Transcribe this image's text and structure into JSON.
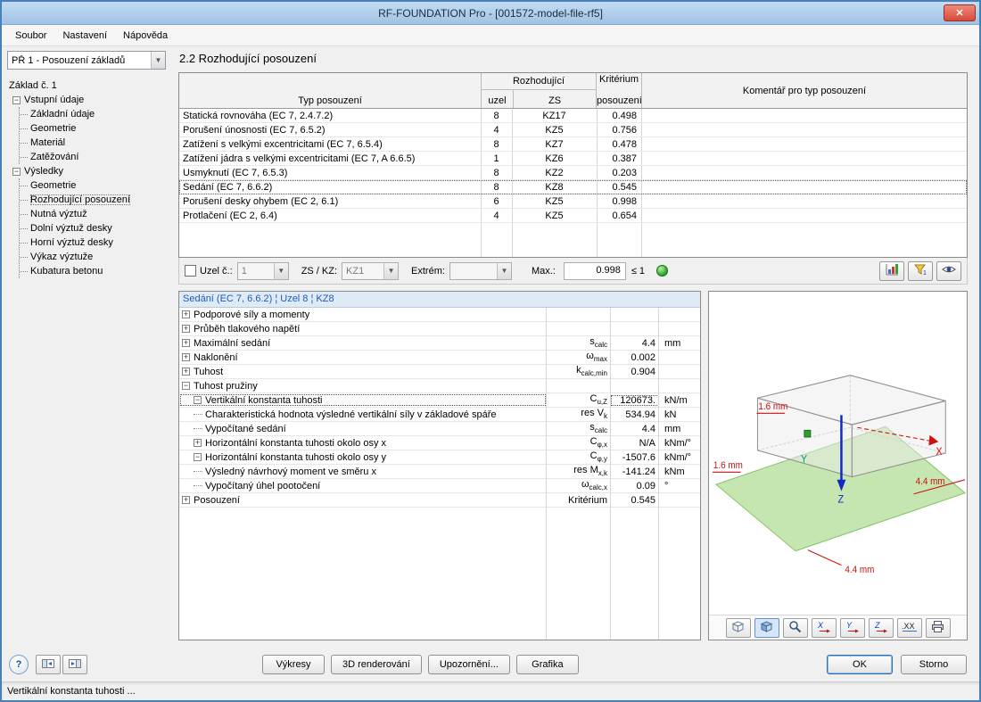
{
  "window": {
    "title": "RF-FOUNDATION Pro - [001572-model-file-rf5]",
    "close_glyph": "✕"
  },
  "menu": {
    "items": [
      "Soubor",
      "Nastavení",
      "Nápověda"
    ]
  },
  "navigation": {
    "case_selector": "PŘ 1 - Posouzení základů",
    "tree": [
      {
        "label": "Základ č. 1",
        "level": 0,
        "exp": ""
      },
      {
        "label": "Vstupní údaje",
        "level": 1,
        "exp": "-"
      },
      {
        "label": "Základní údaje",
        "level": 2,
        "exp": ""
      },
      {
        "label": "Geometrie",
        "level": 2,
        "exp": ""
      },
      {
        "label": "Materiál",
        "level": 2,
        "exp": ""
      },
      {
        "label": "Zatěžování",
        "level": 2,
        "exp": ""
      },
      {
        "label": "Výsledky",
        "level": 1,
        "exp": "-"
      },
      {
        "label": "Geometrie",
        "level": 2,
        "exp": ""
      },
      {
        "label": "Rozhodující posouzení",
        "level": 2,
        "exp": "",
        "selected": true
      },
      {
        "label": "Nutná výztuž",
        "level": 2,
        "exp": ""
      },
      {
        "label": "Dolní výztuž desky",
        "level": 2,
        "exp": ""
      },
      {
        "label": "Horní výztuž desky",
        "level": 2,
        "exp": ""
      },
      {
        "label": "Výkaz výztuže",
        "level": 2,
        "exp": ""
      },
      {
        "label": "Kubatura betonu",
        "level": 2,
        "exp": ""
      }
    ]
  },
  "section": {
    "title": "2.2 Rozhodující posouzení"
  },
  "results_table": {
    "headers": {
      "type": "Typ posouzení",
      "governing": "Rozhodující",
      "node": "uzel",
      "zs": "ZS",
      "criterion_line1": "Kritérium",
      "criterion_line2": "posouzení",
      "comment": "Komentář pro typ posouzení"
    },
    "rows": [
      {
        "type": "Statická rovnováha (EC 7, 2.4.7.2)",
        "node": "8",
        "zs": "KZ17",
        "criterion": "0.498",
        "comment": ""
      },
      {
        "type": "Porušení únosnosti (EC 7, 6.5.2)",
        "node": "4",
        "zs": "KZ5",
        "criterion": "0.756",
        "comment": ""
      },
      {
        "type": "Zatížení s velkými excentricitami (EC 7, 6.5.4)",
        "node": "8",
        "zs": "KZ7",
        "criterion": "0.478",
        "comment": ""
      },
      {
        "type": "Zatížení jádra s velkými excentricitami (EC 7, A 6.6.5)",
        "node": "1",
        "zs": "KZ6",
        "criterion": "0.387",
        "comment": ""
      },
      {
        "type": "Usmyknutí (EC 7, 6.5.3)",
        "node": "8",
        "zs": "KZ2",
        "criterion": "0.203",
        "comment": ""
      },
      {
        "type": "Sedání (EC 7, 6.6.2)",
        "node": "8",
        "zs": "KZ8",
        "criterion": "0.545",
        "comment": "",
        "selected": true
      },
      {
        "type": "Porušení desky ohybem (EC 2, 6.1)",
        "node": "6",
        "zs": "KZ5",
        "criterion": "0.998",
        "comment": ""
      },
      {
        "type": "Protlačení (EC 2, 6.4)",
        "node": "4",
        "zs": "KZ5",
        "criterion": "0.654",
        "comment": ""
      }
    ]
  },
  "filter_bar": {
    "node_label": "Uzel č.:",
    "node_value": "1",
    "zs_label": "ZS / KZ:",
    "zs_value": "KZ1",
    "extreme_label": "Extrém:",
    "extreme_value": "",
    "max_label": "Max.:",
    "max_value": "0.998",
    "max_limit": "≤ 1",
    "status_icon": "green-ok-ball",
    "buttons": [
      "result-diagrams",
      "criterion-filter",
      "visibility"
    ]
  },
  "detail": {
    "header": "Sedání (EC 7, 6.6.2) ¦ Uzel 8 ¦ KZ8",
    "rows": [
      {
        "exp": "+",
        "level": 0,
        "label": "Podporové síly a momenty",
        "sym": "",
        "sub": "",
        "val": "",
        "unit": ""
      },
      {
        "exp": "+",
        "level": 0,
        "label": "Průběh tlakového napětí",
        "sym": "",
        "sub": "",
        "val": "",
        "unit": ""
      },
      {
        "exp": "+",
        "level": 0,
        "label": "Maximální sedání",
        "sym": "s",
        "sub": "calc",
        "val": "4.4",
        "unit": "mm"
      },
      {
        "exp": "+",
        "level": 0,
        "label": "Naklonění",
        "sym": "ω",
        "sub": "max",
        "val": "0.002",
        "unit": ""
      },
      {
        "exp": "+",
        "level": 0,
        "label": "Tuhost",
        "sym": "k",
        "sub": "calc,min",
        "val": "0.904",
        "unit": ""
      },
      {
        "exp": "-",
        "level": 0,
        "label": "Tuhost pružiny",
        "sym": "",
        "sub": "",
        "val": "",
        "unit": ""
      },
      {
        "exp": "-",
        "level": 1,
        "label": "Vertikální konstanta tuhosti",
        "sym": "C",
        "sub": "u,Z",
        "val": "120673.",
        "unit": "kN/m",
        "selected": true
      },
      {
        "exp": "",
        "level": 2,
        "label": "Charakteristická hodnota výsledné vertikální síly v základové spáře",
        "sym": "res V",
        "sub": "k",
        "val": "534.94",
        "unit": "kN"
      },
      {
        "exp": "",
        "level": 2,
        "label": "Vypočítané sedání",
        "sym": "s",
        "sub": "calc",
        "val": "4.4",
        "unit": "mm"
      },
      {
        "exp": "+",
        "level": 1,
        "label": "Horizontální konstanta tuhosti okolo osy x",
        "sym": "C",
        "sub": "φ,x",
        "val": "N/A",
        "unit": "kNm/°"
      },
      {
        "exp": "-",
        "level": 1,
        "label": "Horizontální konstanta tuhosti okolo osy y",
        "sym": "C",
        "sub": "φ,y",
        "val": "-1507.6",
        "unit": "kNm/°"
      },
      {
        "exp": "",
        "level": 2,
        "label": "Výsledný návrhový moment ve směru x",
        "sym": "res M",
        "sub": "x,k",
        "val": "-141.24",
        "unit": "kNm"
      },
      {
        "exp": "",
        "level": 2,
        "label": "Vypočítaný úhel pootočení",
        "sym": "ω",
        "sub": "calc,x",
        "val": "0.09",
        "unit": "°"
      },
      {
        "exp": "+",
        "level": 0,
        "label": "Posouzení",
        "sym": "Kritérium",
        "sub": "",
        "val": "0.545",
        "unit": ""
      }
    ]
  },
  "render_panel": {
    "dim_top": "1.6 mm",
    "dim_left": "1.6 mm",
    "dim_right": "4.4 mm",
    "dim_bottom": "4.4 mm",
    "axis_x": "X",
    "axis_y": "Y",
    "axis_z": "Z",
    "accent_colors": {
      "dimension": "#cc1111",
      "axis_x": "#cc1111",
      "axis_y": "#00998a",
      "axis_z": "#1028c8",
      "plane": "#b8e09e"
    },
    "toolbar": [
      "isometric-view",
      "solid-view",
      "zoom-view",
      "view-x",
      "view-y",
      "view-z",
      "decimal-places",
      "print"
    ]
  },
  "footer": {
    "help": "?",
    "left_buttons": [
      "prev-table",
      "next-table"
    ],
    "buttons": [
      "Výkresy",
      "3D renderování",
      "Upozornění...",
      "Grafika"
    ],
    "button_names": [
      "drawings",
      "3d-rendering",
      "messages",
      "graphics"
    ],
    "ok": "OK",
    "cancel": "Storno"
  },
  "statusbar": {
    "text": "Vertikální konstanta tuhosti ..."
  }
}
